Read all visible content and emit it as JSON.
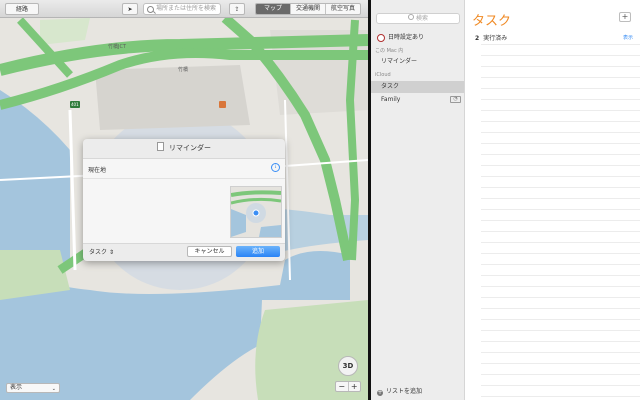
{
  "maps": {
    "toolbar": {
      "route_label": "経路",
      "search_placeholder": "場所または住所を検索",
      "modes": [
        "マップ",
        "交通機関",
        "航空写真"
      ]
    },
    "labels": {
      "junction": "竹橋JCT",
      "area": "竹橋",
      "route_shield": "401"
    },
    "display_select": "表示",
    "zoom_out": "−",
    "zoom_in": "+",
    "btn_3d": "3D"
  },
  "dialog": {
    "title": "リマインダー",
    "location": "現在地",
    "list_select": "タスク",
    "cancel_label": "キャンセル",
    "add_label": "追加"
  },
  "reminders": {
    "search_placeholder": "検索",
    "scheduled": "日時設定あり",
    "section_mac": "この Mac 内",
    "mac_list": "リマインダー",
    "section_icloud": "iCloud",
    "icloud_lists": [
      "タスク",
      "Family"
    ],
    "add_list": "リストを追加",
    "title": "タスク",
    "completed_count": "2",
    "completed_label": "実行済み",
    "show_label": "表示"
  },
  "colors": {
    "accent_orange": "#f08a24",
    "link_blue": "#3a8ef5",
    "map_water": "#a4c5dd",
    "map_green": "#7dc77a",
    "map_park": "#c7deb9"
  }
}
